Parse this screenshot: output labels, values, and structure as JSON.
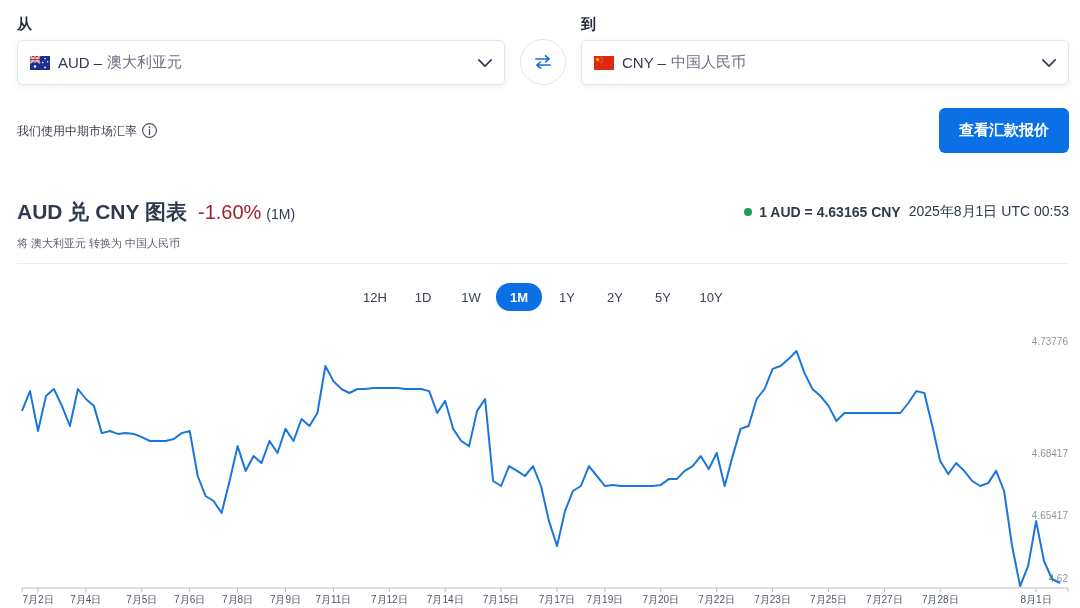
{
  "currency_fields": [
    {
      "label": "从",
      "code": "AUD –",
      "name": "澳大利亚元"
    },
    {
      "label": "到",
      "code": "CNY –",
      "name": "中国人民币"
    }
  ],
  "rate_note": "我们使用中期市场汇率",
  "quote_button": "查看汇款报价",
  "chart_header": {
    "title": "AUD 兑 CNY 图表",
    "change": "-1.60%",
    "period": "(1M)",
    "rate": "1 AUD = 4.63165 CNY",
    "timestamp": "2025年8月1日 UTC 00:53",
    "subtitle": "将 澳大利亚元 转换为 中国人民币"
  },
  "periods": [
    {
      "label": "12H",
      "selected": false
    },
    {
      "label": "1D",
      "selected": false
    },
    {
      "label": "1W",
      "selected": false
    },
    {
      "label": "1M",
      "selected": true
    },
    {
      "label": "1Y",
      "selected": false
    },
    {
      "label": "2Y",
      "selected": false
    },
    {
      "label": "5Y",
      "selected": false
    },
    {
      "label": "10Y",
      "selected": false
    }
  ],
  "chart": {
    "chart_data": {
      "type": "line",
      "categories": [
        null,
        null,
        "7月2日",
        null,
        null,
        null,
        null,
        null,
        "7月4日",
        null,
        null,
        null,
        null,
        null,
        null,
        "7月5日",
        null,
        null,
        null,
        null,
        null,
        "7月6日",
        null,
        null,
        null,
        null,
        null,
        "7月8日",
        null,
        null,
        null,
        null,
        null,
        "7月9日",
        null,
        null,
        null,
        null,
        null,
        "7月11日",
        null,
        null,
        null,
        null,
        null,
        null,
        "7月12日",
        null,
        null,
        null,
        null,
        null,
        null,
        "7月14日",
        null,
        null,
        null,
        null,
        null,
        null,
        "7月15日",
        null,
        null,
        null,
        null,
        null,
        null,
        "7月17日",
        null,
        null,
        null,
        null,
        null,
        "7月19日",
        null,
        null,
        null,
        null,
        null,
        null,
        "7月20日",
        null,
        null,
        null,
        null,
        null,
        null,
        "7月22日",
        null,
        null,
        null,
        null,
        null,
        null,
        "7月23日",
        null,
        null,
        null,
        null,
        null,
        null,
        "7月25日",
        null,
        null,
        null,
        null,
        null,
        null,
        "7月27日",
        null,
        null,
        null,
        null,
        null,
        null,
        "7月28日",
        null,
        null,
        null,
        null,
        null,
        null,
        null,
        null,
        null,
        null,
        null,
        "8月1日",
        null,
        null,
        null
      ],
      "series": [
        {
          "color": "#1a76d9",
          "values": [
            4.7043,
            4.7138,
            4.6947,
            4.7114,
            4.7148,
            4.7067,
            4.6971,
            4.7148,
            4.71,
            4.7067,
            4.6937,
            4.6947,
            4.6933,
            4.6937,
            4.6933,
            4.6918,
            4.6899,
            4.6899,
            4.6899,
            4.6909,
            4.6937,
            4.6947,
            4.6732,
            4.6636,
            4.6612,
            4.6555,
            4.6708,
            4.6875,
            4.6756,
            4.6827,
            4.6794,
            4.6899,
            4.6842,
            4.6957,
            4.6899,
            4.7004,
            4.6971,
            4.7033,
            4.7258,
            4.7186,
            4.7148,
            4.7129,
            4.7148,
            4.7148,
            4.7153,
            4.7153,
            4.7153,
            4.7153,
            4.7148,
            4.7148,
            4.7148,
            4.7138,
            4.7033,
            4.7091,
            4.6957,
            4.6899,
            4.6875,
            4.7043,
            4.71,
            4.6708,
            4.6684,
            4.6779,
            4.6756,
            4.6732,
            4.6779,
            4.6684,
            4.6516,
            4.6397,
            4.6564,
            4.666,
            4.6684,
            4.6779,
            4.6732,
            4.6684,
            4.6689,
            4.6684,
            4.6684,
            4.6684,
            4.6684,
            4.6684,
            4.6689,
            4.6717,
            4.6717,
            4.6756,
            4.6779,
            4.6827,
            4.6765,
            4.6842,
            4.6684,
            4.6827,
            4.6957,
            4.6971,
            4.71,
            4.7148,
            4.7244,
            4.7258,
            4.7291,
            4.733,
            4.7224,
            4.7148,
            4.7114,
            4.7067,
            4.6995,
            4.7033,
            4.7033,
            4.7033,
            4.7033,
            4.7033,
            4.7033,
            4.7033,
            4.7033,
            4.7081,
            4.7138,
            4.7129,
            4.6971,
            4.6803,
            4.6741,
            4.6794,
            4.6756,
            4.6708,
            4.6684,
            4.6698,
            4.6756,
            4.666,
            4.6397,
            4.6205,
            4.6301,
            4.6516,
            4.6325,
            4.6239,
            4.622
          ]
        }
      ],
      "ylim": [
        4.6196,
        4.73776
      ],
      "yticks": [
        4.73776,
        4.68417,
        4.65417,
        {
          "value": 4.62417,
          "label": "4.62"
        }
      ]
    }
  }
}
